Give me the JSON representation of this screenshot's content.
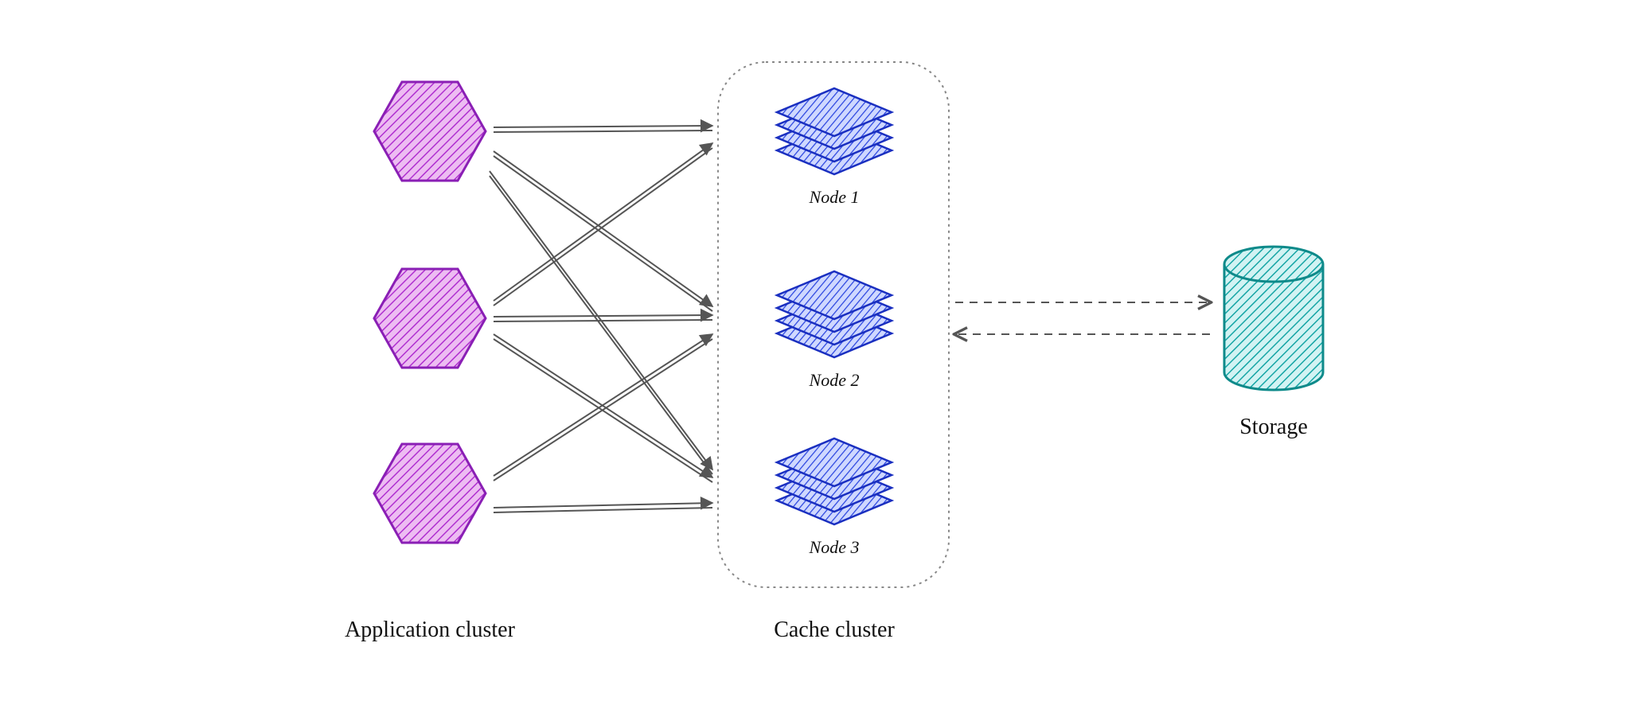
{
  "diagram": {
    "app_cluster_label": "Application cluster",
    "cache_cluster_label": "Cache cluster",
    "storage_label": "Storage",
    "nodes": [
      {
        "label": "Node 1"
      },
      {
        "label": "Node 2"
      },
      {
        "label": "Node 3"
      }
    ],
    "colors": {
      "app_hexagon_stroke": "#a020c0",
      "app_hexagon_fill": "#d070e0",
      "cache_node_stroke": "#2040d0",
      "cache_node_fill": "#4060f0",
      "storage_stroke": "#109090",
      "storage_fill": "#30c0c0",
      "arrows": "#555555"
    },
    "components": {
      "app_instances": 3,
      "cache_nodes": 3,
      "storage": 1
    },
    "arrows": {
      "app_to_cache": "solid_doubleline",
      "cache_to_storage": "dashed_bidirectional"
    }
  }
}
